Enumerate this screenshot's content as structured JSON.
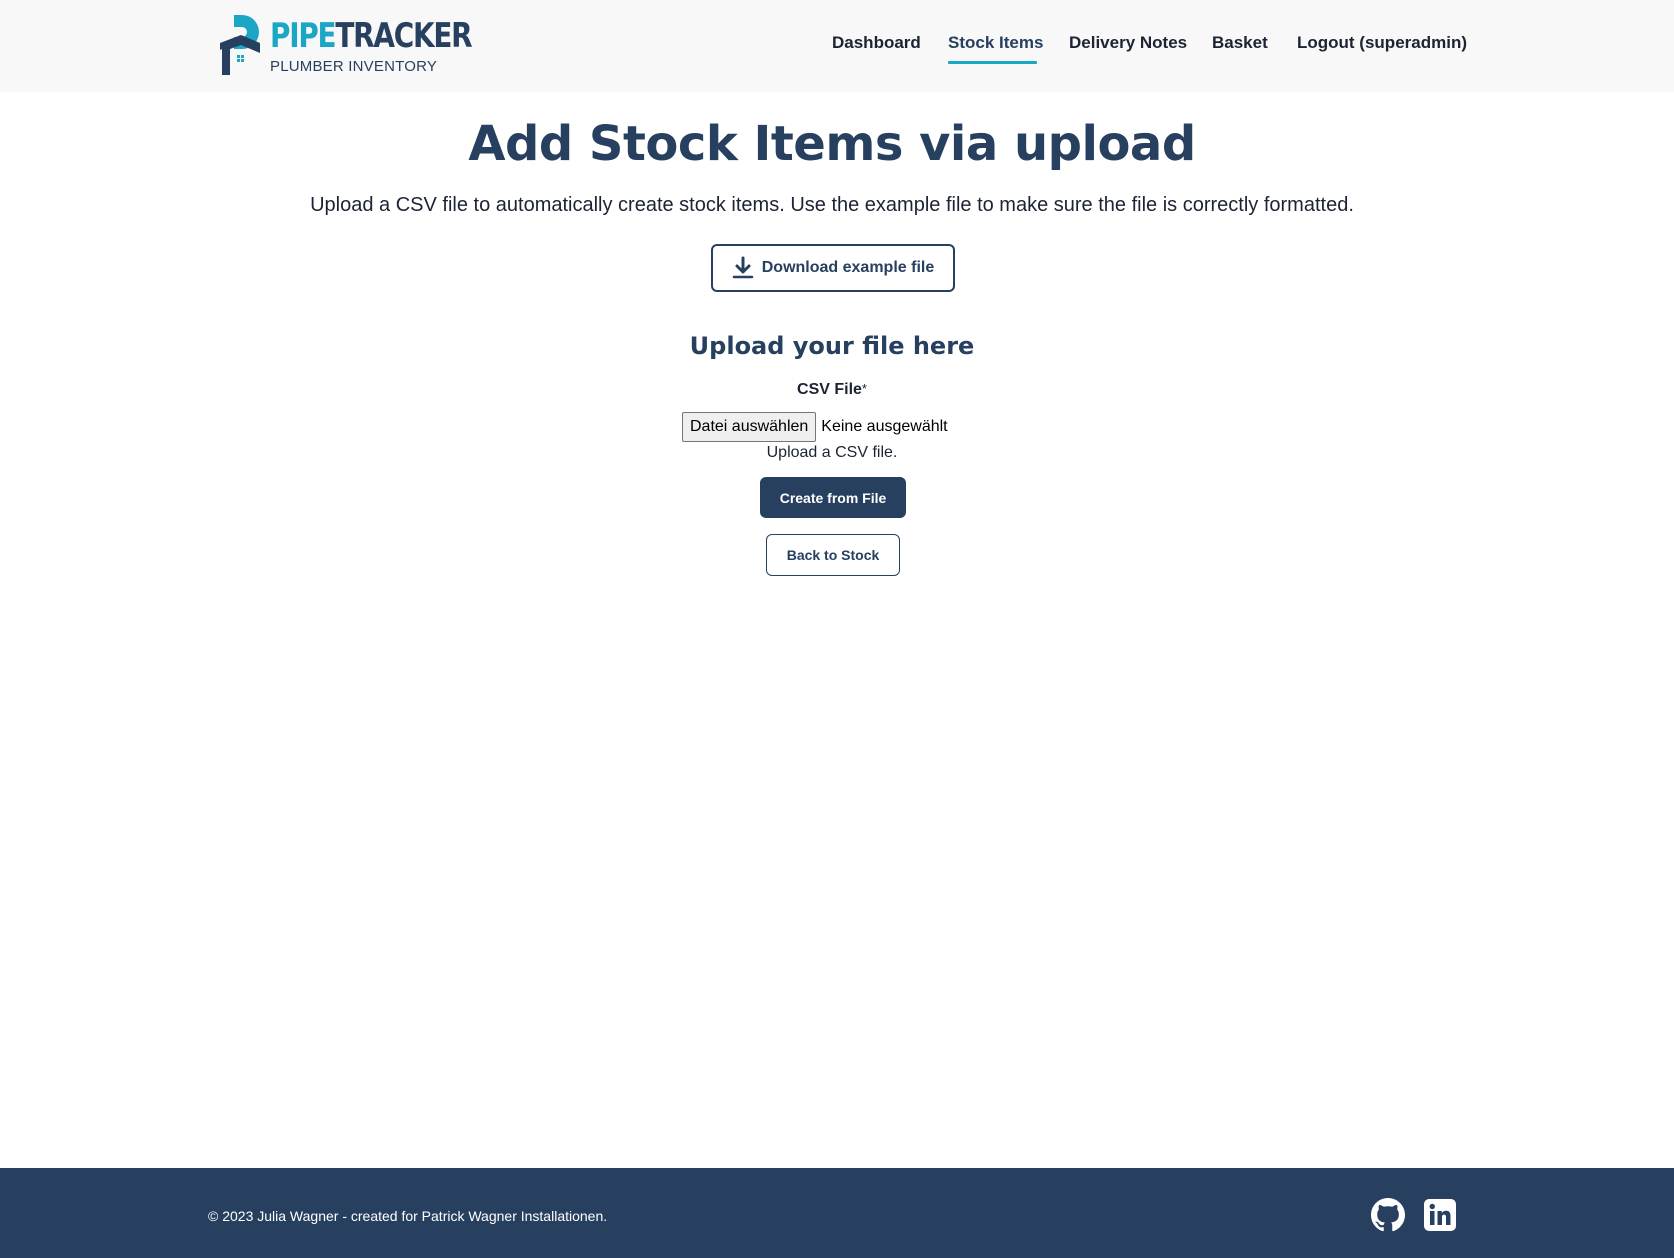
{
  "header": {
    "logo": {
      "word_part1": "PIPE",
      "word_part2": "TRACKER",
      "subtitle": "PLUMBER INVENTORY"
    },
    "nav": [
      {
        "label": "Dashboard",
        "active": false
      },
      {
        "label": "Stock Items",
        "active": true
      },
      {
        "label": "Delivery Notes",
        "active": false
      },
      {
        "label": "Basket",
        "active": false
      },
      {
        "label": "Logout (superadmin)",
        "active": false
      }
    ]
  },
  "main": {
    "title": "Add Stock Items via upload",
    "intro": "Upload a CSV file to automatically create stock items. Use the example file to make sure the file is correctly formatted.",
    "download_button": {
      "label": "Download example file",
      "icon": "download-icon"
    },
    "upload_heading": "Upload your file here",
    "csv_field": {
      "label": "CSV File",
      "required_marker": "*",
      "choose_button": "Datei auswählen",
      "status": "Keine ausgewählt",
      "help_text": "Upload a CSV file."
    },
    "create_button": "Create from File",
    "back_button": "Back to Stock"
  },
  "footer": {
    "copyright": "© 2023 Julia Wagner - created for Patrick Wagner Installationen.",
    "social": [
      {
        "name": "github-icon"
      },
      {
        "name": "linkedin-icon"
      }
    ]
  },
  "colors": {
    "brand_dark": "#27405f",
    "brand_accent": "#1aa6c4",
    "header_bg": "#f8f8f8",
    "footer_bg": "#27405f"
  }
}
